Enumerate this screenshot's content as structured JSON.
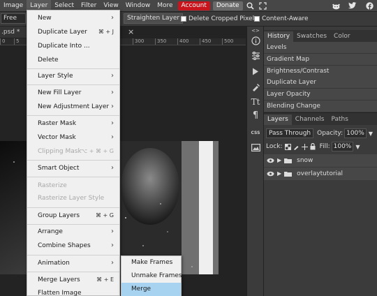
{
  "menubar": {
    "items": [
      "Image",
      "Layer",
      "Select",
      "Filter",
      "View",
      "Window",
      "More"
    ],
    "account": "Account",
    "donate": "Donate"
  },
  "optbar": {
    "mode": "Free",
    "straighten": "Straighten Layer",
    "delete_cropped": "Delete Cropped Pixels",
    "content_aware": "Content-Aware"
  },
  "doc": {
    "tab_title": ".psd *",
    "close": "×",
    "ruler_left": [
      "0",
      "5"
    ],
    "ruler_right": [
      "300",
      "350",
      "400",
      "450",
      "500"
    ]
  },
  "layer_menu": {
    "new": "New",
    "duplicate_layer": "Duplicate Layer",
    "duplicate_layer_sc": "⌘ + J",
    "duplicate_into": "Duplicate Into ...",
    "delete": "Delete",
    "layer_style": "Layer Style",
    "new_fill_layer": "New Fill Layer",
    "new_adjustment_layer": "New Adjustment Layer",
    "raster_mask": "Raster Mask",
    "vector_mask": "Vector Mask",
    "clipping_mask": "Clipping Mask",
    "clipping_mask_sc": "⌥ + ⌘ + G",
    "smart_object": "Smart Object",
    "rasterize": "Rasterize",
    "rasterize_layer_style": "Rasterize Layer Style",
    "group_layers": "Group Layers",
    "group_layers_sc": "⌘ + G",
    "arrange": "Arrange",
    "combine_shapes": "Combine Shapes",
    "animation": "Animation",
    "merge_layers": "Merge Layers",
    "merge_layers_sc": "⌘ + E",
    "flatten_image": "Flatten Image"
  },
  "animation_submenu": {
    "make_frames": "Make Frames",
    "unmake_frames": "Unmake Frames",
    "merge": "Merge"
  },
  "history_panel": {
    "tabs": [
      "History",
      "Swatches",
      "Color"
    ],
    "rows": [
      "Levels",
      "Gradient Map",
      "Brightness/Contrast",
      "Duplicate Layer",
      "Layer Opacity",
      "Blending Change"
    ]
  },
  "layers_panel": {
    "tabs": [
      "Layers",
      "Channels",
      "Paths"
    ],
    "blend_mode": "Pass Through",
    "opacity_label": "Opacity:",
    "opacity_value": "100%",
    "lock_label": "Lock:",
    "fill_label": "Fill:",
    "fill_value": "100%",
    "layers": [
      "snow",
      "overlaytutorial"
    ]
  },
  "toolbar": {
    "css_label": "CSS"
  },
  "colors": {
    "account_bg": "#c8141c",
    "highlight": "#a8d3f0",
    "menu_bg": "#f0f0f0"
  }
}
